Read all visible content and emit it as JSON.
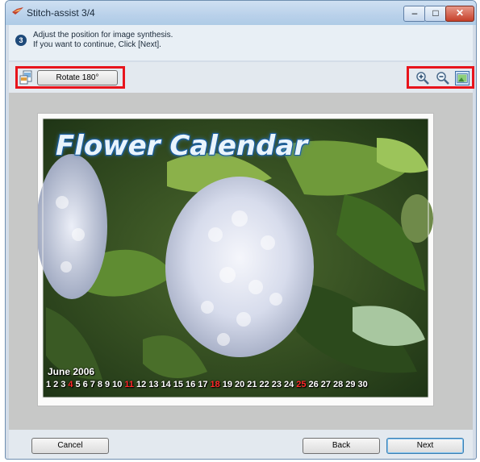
{
  "window": {
    "title": "Stitch-assist 3/4",
    "controls": {
      "minimize": "–",
      "maximize": "□",
      "close": "✕"
    }
  },
  "info": {
    "step": "3",
    "line1": "Adjust the position for image synthesis.",
    "line2": "If you want to continue, Click [Next]."
  },
  "toolbar": {
    "rotate_label": "Rotate 180°",
    "rotate_icon": "rotate-image-icon",
    "zoom_in_icon": "zoom-in-icon",
    "zoom_out_icon": "zoom-out-icon",
    "fit_icon": "fit-to-window-icon"
  },
  "preview": {
    "title": "Flower Calendar",
    "month": "June 2006",
    "days": [
      "1",
      "2",
      "3",
      "4",
      "5",
      "6",
      "7",
      "8",
      "9",
      "10",
      "11",
      "12",
      "13",
      "14",
      "15",
      "16",
      "17",
      "18",
      "19",
      "20",
      "21",
      "22",
      "23",
      "24",
      "25",
      "26",
      "27",
      "28",
      "29",
      "30"
    ],
    "sundays": [
      "4",
      "11",
      "18",
      "25"
    ],
    "sunday_color": "#ff2a2a"
  },
  "footer": {
    "cancel_label": "Cancel",
    "back_label": "Back",
    "next_label": "Next"
  },
  "colors": {
    "highlight": "#e8141c",
    "title_accent": "#1b5fa0"
  }
}
